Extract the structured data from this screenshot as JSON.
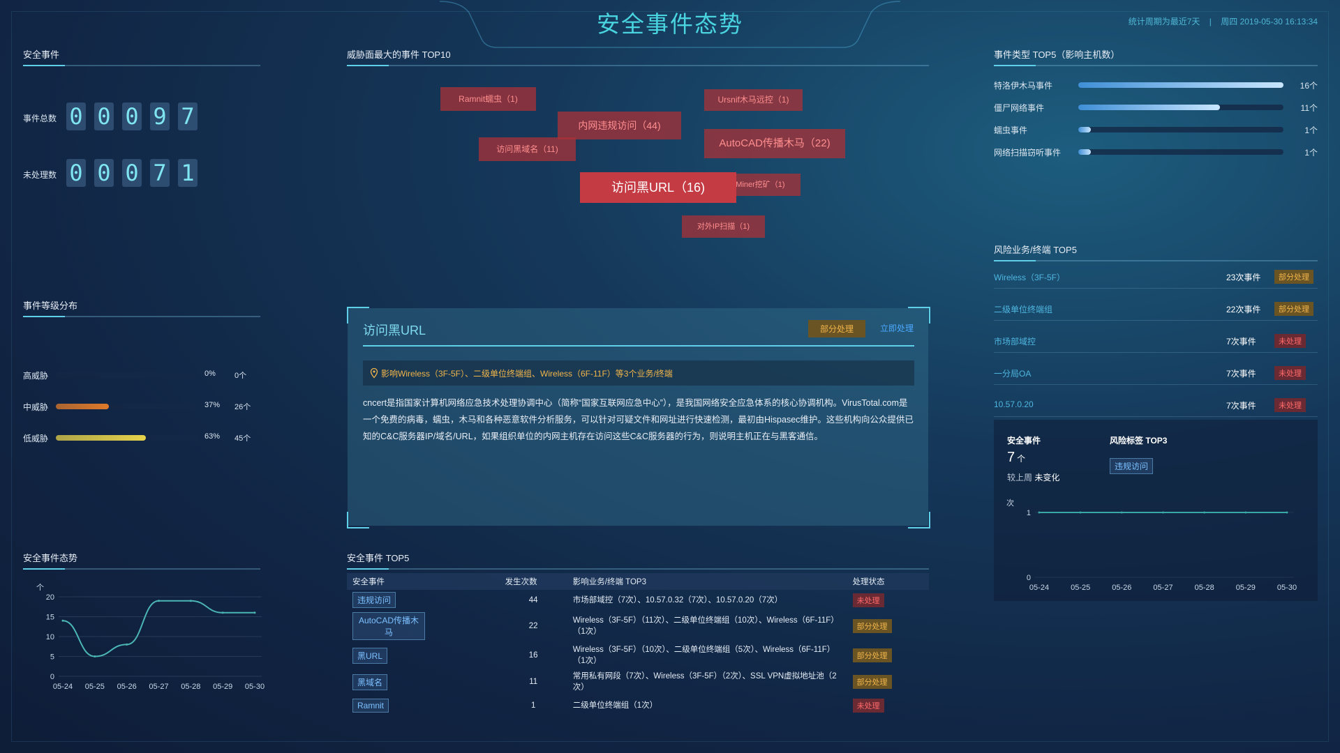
{
  "header": {
    "title": "安全事件态势",
    "period": "统计周期为最近7天",
    "datetime": "周四 2019-05-30 16:13:34"
  },
  "left": {
    "security_events": {
      "title": "安全事件",
      "total_label": "事件总数",
      "total_digits": [
        "0",
        "0",
        "0",
        "9",
        "7"
      ],
      "unhandled_label": "未处理数",
      "unhandled_digits": [
        "0",
        "0",
        "0",
        "7",
        "1"
      ]
    },
    "level_dist": {
      "title": "事件等级分布",
      "rows": [
        {
          "label": "高威胁",
          "pct": "0%",
          "count": "0个",
          "fraction": 0.0,
          "color": "#e07a2a"
        },
        {
          "label": "中威胁",
          "pct": "37%",
          "count": "26个",
          "fraction": 0.37,
          "color": "#e07a2a"
        },
        {
          "label": "低威胁",
          "pct": "63%",
          "count": "45个",
          "fraction": 0.63,
          "color": "#e6d24a"
        }
      ]
    },
    "trend": {
      "title": "安全事件态势",
      "chart_data": {
        "type": "line",
        "ylabel": "个",
        "categories": [
          "05-24",
          "05-25",
          "05-26",
          "05-27",
          "05-28",
          "05-29",
          "05-30"
        ],
        "values": [
          14,
          5,
          8,
          19,
          19,
          16,
          16
        ],
        "yticks": [
          "0",
          "5",
          "10",
          "15",
          "20"
        ],
        "ylim": [
          0,
          20
        ],
        "color": "#4bb6b4"
      }
    }
  },
  "center": {
    "top10": {
      "title": "威胁面最大的事件 TOP10",
      "tags": [
        {
          "text": "Ramnit蠕虫（1)"
        },
        {
          "text": "Ursnif木马远控（1)"
        },
        {
          "text": "内网违规访问（44)"
        },
        {
          "text": "AutoCAD传播木马（22)"
        },
        {
          "text": "访问黑域名（11)"
        },
        {
          "text": "访问黑URL（16)"
        },
        {
          "text": "KoiMiner挖矿（1)"
        },
        {
          "text": "对外IP扫描（1)"
        }
      ]
    },
    "detail": {
      "title": "访问黑URL",
      "status": "部分处理",
      "action": "立即处理",
      "impact": "影响Wireless（3F-5F）、二级单位终端组、Wireless（6F-11F）等3个业务/终端",
      "description": "cncert是指国家计算机网络应急技术处理协调中心（简称“国家互联网应急中心”），是我国网络安全应急体系的核心协调机构。VirusTotal.com是一个免费的病毒，蠕虫，木马和各种恶意软件分析服务，可以针对可疑文件和网址进行快速检测，最初由Hispasec维护。这些机构向公众提供已知的C&C服务器IP/域名/URL，如果组织单位的内网主机存在访问这些C&C服务器的行为，则说明主机正在与黑客通信。"
    },
    "top5": {
      "title": "安全事件 TOP5",
      "columns": [
        "安全事件",
        "发生次数",
        "影响业务/终端 TOP3",
        "处理状态"
      ],
      "rows": [
        {
          "event": "违规访问",
          "count": "44",
          "impact": "市场部域控（7次）、10.57.0.32（7次）、10.57.0.20（7次）",
          "status": "未处理",
          "status_type": "unhandled"
        },
        {
          "event": "AutoCAD传播木马",
          "count": "22",
          "impact": "Wireless（3F-5F）（11次）、二级单位终端组（10次）、Wireless（6F-11F）（1次）",
          "status": "部分处理",
          "status_type": "partial"
        },
        {
          "event": "黑URL",
          "count": "16",
          "impact": "Wireless（3F-5F）（10次）、二级单位终端组（5次）、Wireless（6F-11F）（1次）",
          "status": "部分处理",
          "status_type": "partial"
        },
        {
          "event": "黑域名",
          "count": "11",
          "impact": "常用私有网段（7次）、Wireless（3F-5F）（2次）、SSL VPN虚拟地址池（2次）",
          "status": "部分处理",
          "status_type": "partial"
        },
        {
          "event": "Ramnit",
          "count": "1",
          "impact": "二级单位终端组（1次）",
          "status": "未处理",
          "status_type": "unhandled"
        }
      ]
    }
  },
  "right": {
    "types": {
      "title": "事件类型 TOP5（影响主机数）",
      "rows": [
        {
          "label": "特洛伊木马事件",
          "value": "16个",
          "fraction": 1.0
        },
        {
          "label": "僵尸网络事件",
          "value": "11个",
          "fraction": 0.69
        },
        {
          "label": "蠕虫事件",
          "value": "1个",
          "fraction": 0.06
        },
        {
          "label": "网络扫描窃听事件",
          "value": "1个",
          "fraction": 0.06
        }
      ]
    },
    "risk": {
      "title": "风险业务/终端 TOP5",
      "rows": [
        {
          "name": "Wireless（3F-5F）",
          "count": "23次事件",
          "status": "部分处理",
          "status_type": "partial"
        },
        {
          "name": "二级单位终端组",
          "count": "22次事件",
          "status": "部分处理",
          "status_type": "partial"
        },
        {
          "name": "市场部域控",
          "count": "7次事件",
          "status": "未处理",
          "status_type": "unhandled"
        },
        {
          "name": "一分局OA",
          "count": "7次事件",
          "status": "未处理",
          "status_type": "unhandled"
        },
        {
          "name": "10.57.0.20",
          "count": "7次事件",
          "status": "未处理",
          "status_type": "unhandled"
        }
      ]
    },
    "sub": {
      "events_label": "安全事件",
      "events_value": "7",
      "events_unit": "个",
      "compare_label": "较上周",
      "compare_value": "未变化",
      "tags_label": "风险标签 TOP3",
      "tag": "违规访问",
      "chart_data": {
        "type": "line",
        "ylabel": "次",
        "categories": [
          "05-24",
          "05-25",
          "05-26",
          "05-27",
          "05-28",
          "05-29",
          "05-30"
        ],
        "values": [
          1,
          1,
          1,
          1,
          1,
          1,
          1
        ],
        "yticks": [
          "0",
          "1"
        ],
        "ylim": [
          0,
          1
        ],
        "color": "#3aa8a8"
      }
    }
  }
}
